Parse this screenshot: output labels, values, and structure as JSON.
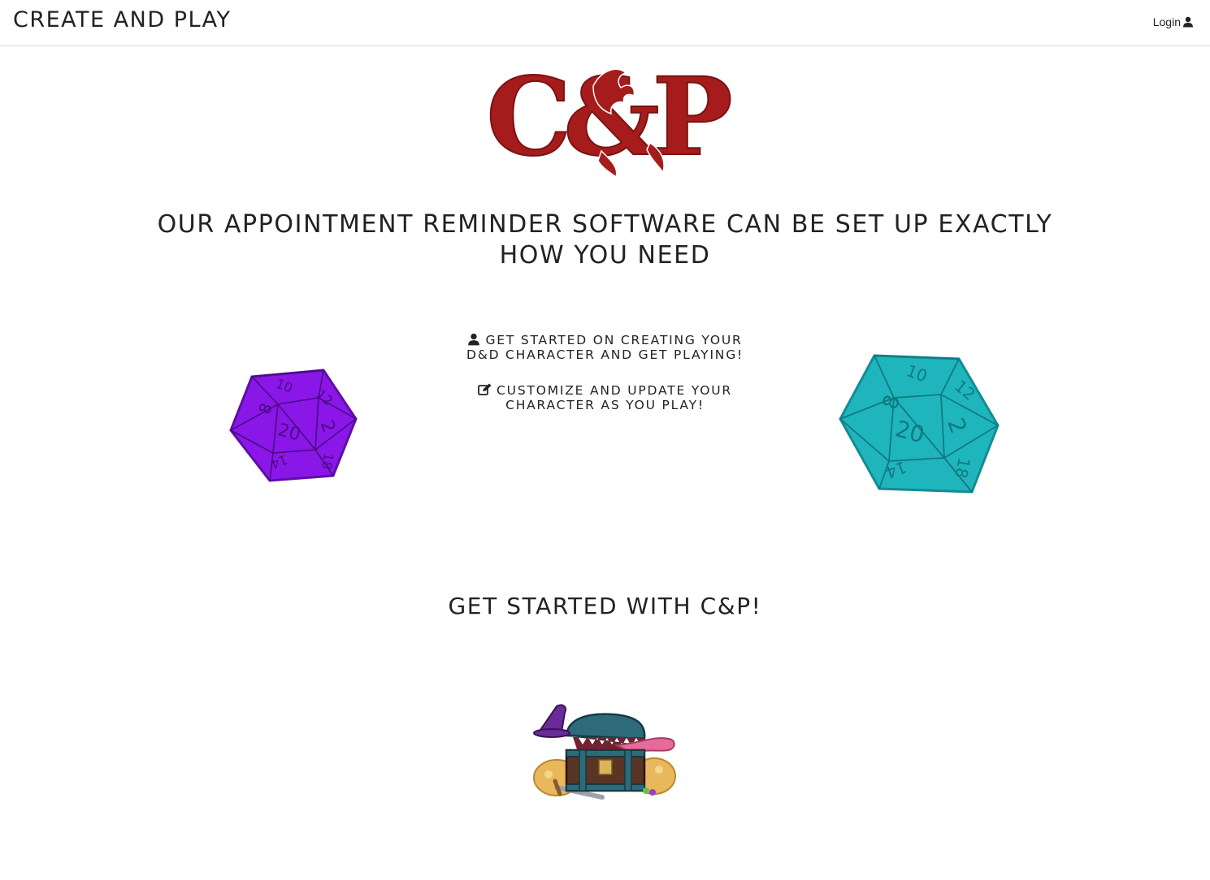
{
  "navbar": {
    "brand": "CREATE AND PLAY",
    "login_label": "Login",
    "login_icon": "user-icon"
  },
  "hero": {
    "logo_text": "C&P",
    "headline_line1": "OUR APPOINTMENT REMINDER SOFTWARE CAN BE SET UP EXACTLY",
    "headline_line2": "HOW YOU NEED"
  },
  "features": [
    {
      "icon": "user-icon",
      "line1": "GET STARTED ON CREATING YOUR",
      "line2": "D&D CHARACTER AND GET PLAYING!"
    },
    {
      "icon": "edit-icon",
      "line1": "CUSTOMIZE AND UPDATE YOUR",
      "line2": "CHARACTER AS YOU PLAY!"
    }
  ],
  "dice": {
    "left": {
      "color": "#8a17e8",
      "numbers": [
        "10",
        "12",
        "8",
        "20",
        "2",
        "14",
        "18"
      ]
    },
    "right": {
      "color": "#1fb5bd",
      "numbers": [
        "10",
        "12",
        "8",
        "20",
        "2",
        "14",
        "18"
      ]
    }
  },
  "cta": {
    "heading": "GET STARTED WITH C&P!"
  },
  "colors": {
    "logo_red": "#a61c1c",
    "text": "#222222",
    "divider": "#dcdcdc"
  }
}
